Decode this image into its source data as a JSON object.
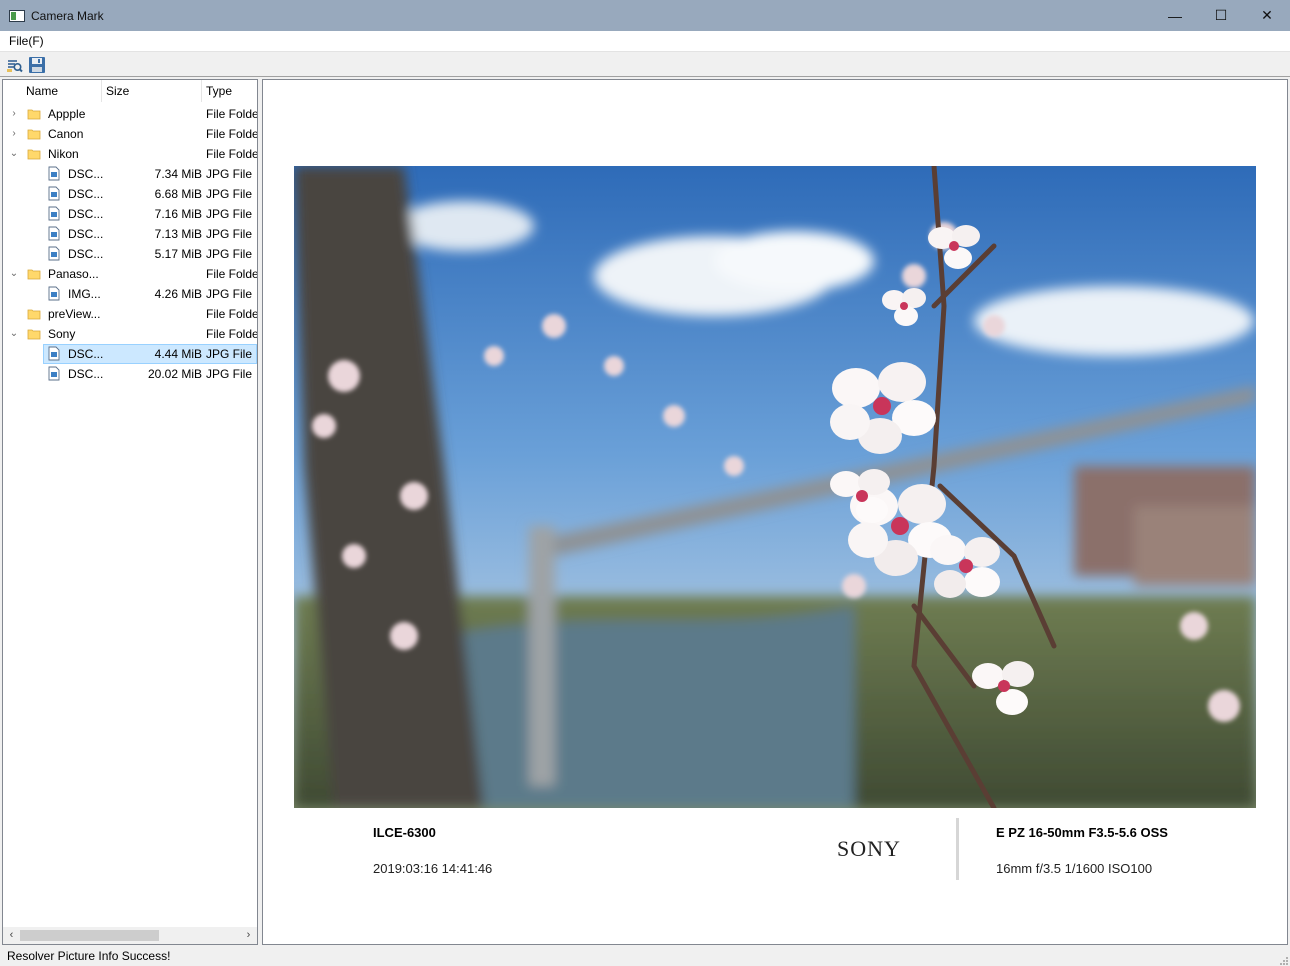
{
  "window": {
    "title": "Camera Mark",
    "minimize": "—",
    "maximize": "☐",
    "close": "✕"
  },
  "menu": {
    "file_label": "File(F)"
  },
  "toolbar": {
    "open_icon": "open-folder-search-icon",
    "save_icon": "floppy-save-icon"
  },
  "tree": {
    "columns": {
      "name": "Name",
      "size": "Size",
      "type": "Type"
    },
    "rows": [
      {
        "kind": "folder",
        "chevron": "›",
        "name": "Appple",
        "size": "",
        "type": "File Folde"
      },
      {
        "kind": "folder",
        "chevron": "›",
        "name": "Canon",
        "size": "",
        "type": "File Folde"
      },
      {
        "kind": "folder",
        "chevron": "⌄",
        "name": "Nikon",
        "size": "",
        "type": "File Folde"
      },
      {
        "kind": "file",
        "chevron": "",
        "name": "DSC...",
        "size": "7.34 MiB",
        "type": "JPG File"
      },
      {
        "kind": "file",
        "chevron": "",
        "name": "DSC...",
        "size": "6.68 MiB",
        "type": "JPG File"
      },
      {
        "kind": "file",
        "chevron": "",
        "name": "DSC...",
        "size": "7.16 MiB",
        "type": "JPG File"
      },
      {
        "kind": "file",
        "chevron": "",
        "name": "DSC...",
        "size": "7.13 MiB",
        "type": "JPG File"
      },
      {
        "kind": "file",
        "chevron": "",
        "name": "DSC...",
        "size": "5.17 MiB",
        "type": "JPG File"
      },
      {
        "kind": "folder",
        "chevron": "⌄",
        "name": "Panaso...",
        "size": "",
        "type": "File Folde"
      },
      {
        "kind": "file",
        "chevron": "",
        "name": "IMG...",
        "size": "4.26 MiB",
        "type": "JPG File"
      },
      {
        "kind": "folder",
        "chevron": "",
        "name": "preView...",
        "size": "",
        "type": "File Folde"
      },
      {
        "kind": "folder",
        "chevron": "⌄",
        "name": "Sony",
        "size": "",
        "type": "File Folde"
      },
      {
        "kind": "file",
        "chevron": "",
        "name": "DSC...",
        "size": "4.44 MiB",
        "type": "JPG File",
        "selected": true
      },
      {
        "kind": "file",
        "chevron": "",
        "name": "DSC...",
        "size": "20.02 MiB",
        "type": "JPG File"
      }
    ],
    "scroll_left": "‹",
    "scroll_right": "›"
  },
  "preview": {
    "model": "ILCE-6300",
    "datetime": "2019:03:16 14:41:46",
    "brand": "SONY",
    "lens": "E PZ 16-50mm F3.5-5.6 OSS",
    "exif": "16mm f/3.5 1/1600 ISO100"
  },
  "status": {
    "text": "Resolver Picture Info Success!"
  },
  "colors": {
    "titlebar": "#98a9bd",
    "selection": "#cce8ff",
    "folder": "#ffd86b"
  }
}
